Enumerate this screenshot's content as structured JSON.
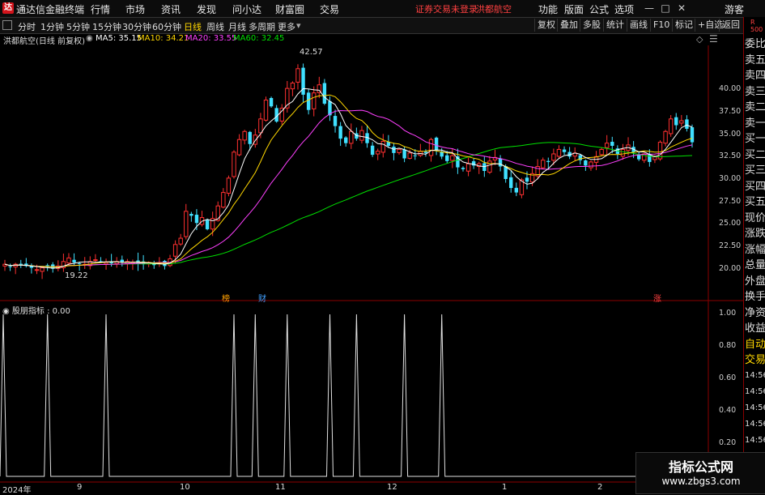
{
  "app": {
    "title": "通达信金融终端",
    "logo": "达"
  },
  "menu": [
    "行情",
    "市场",
    "资讯",
    "发现",
    "问小达",
    "财富圈",
    "交易"
  ],
  "status": {
    "login": "证券交易未登录",
    "stock": "洪都航空"
  },
  "right_menu": [
    "功能",
    "版面",
    "公式",
    "选项",
    "游客"
  ],
  "window_buttons": [
    "—",
    "□",
    "✕"
  ],
  "periods": [
    "分时",
    "1分钟",
    "5分钟",
    "15分钟",
    "30分钟",
    "60分钟",
    "日线",
    "周线",
    "月线",
    "多周期",
    "更多"
  ],
  "active_period": "日线",
  "toolbar_buttons": [
    "复权",
    "叠加",
    "多股",
    "统计",
    "画线",
    "F10",
    "标记",
    "+自选",
    "返回"
  ],
  "right_panel": {
    "head": [
      "R",
      "500"
    ],
    "items": [
      "委比",
      "卖五",
      "卖四",
      "卖三",
      "卖二",
      "卖一",
      "买一",
      "买二",
      "买三",
      "买四",
      "买五",
      "现价",
      "涨跌",
      "涨幅",
      "总量",
      "外盘",
      "换手",
      "净资",
      "收益",
      "自动",
      "交易"
    ],
    "times": [
      "14:56",
      "14:56",
      "14:56",
      "14:56",
      "14:56",
      "14:56",
      "14:56"
    ]
  },
  "legend": {
    "title": "洪都航空(日线 前复权)",
    "ma": [
      {
        "label": "MA5: 35.15",
        "color": "#ffffff"
      },
      {
        "label": "MA10: 34.21",
        "color": "#ffd700"
      },
      {
        "label": "MA20: 33.55",
        "color": "#ff40ff"
      },
      {
        "label": "MA60: 32.45",
        "color": "#00e000"
      }
    ]
  },
  "indicator": {
    "label": "股朋指标 : 0.00"
  },
  "markers": {
    "high": "42.57",
    "low": "19.22",
    "tags": [
      "榜",
      "财",
      "涨"
    ]
  },
  "x_labels": [
    "2024年",
    "9",
    "10",
    "11",
    "12",
    "1",
    "2"
  ],
  "watermark": {
    "title": "指标公式网",
    "url": "www.zbgs3.com"
  },
  "chart_data": [
    {
      "type": "candlestick",
      "title": "洪都航空(日线 前复权)",
      "ylim": [
        17.0,
        45.0
      ],
      "y_ticks": [
        "40.00",
        "37.50",
        "35.00",
        "32.50",
        "30.00",
        "27.50",
        "25.00",
        "22.50",
        "20.00"
      ],
      "close": [
        20.6,
        20.3,
        20.6,
        20.5,
        20.4,
        20.2,
        20.0,
        20.2,
        20.3,
        20.1,
        20.4,
        20.9,
        21.3,
        20.8,
        20.7,
        20.6,
        20.9,
        21.1,
        20.9,
        20.8,
        20.7,
        20.9,
        20.8,
        20.9,
        20.8,
        20.7,
        20.6,
        20.8,
        20.5,
        20.7,
        20.4,
        21.2,
        22.8,
        23.5,
        26.5,
        26.0,
        25.2,
        25.8,
        24.5,
        25.7,
        27.1,
        28.6,
        30.2,
        33.1,
        34.5,
        35.4,
        34.0,
        35.0,
        36.8,
        38.9,
        38.2,
        36.5,
        38.0,
        40.2,
        40.8,
        42.4,
        39.5,
        37.8,
        39.7,
        40.6,
        38.5,
        37.2,
        36.0,
        34.6,
        34.1,
        35.4,
        34.6,
        35.5,
        34.1,
        32.8,
        33.2,
        34.3,
        33.8,
        33.0,
        33.4,
        32.4,
        33.0,
        32.7,
        33.2,
        33.0,
        34.5,
        33.3,
        32.6,
        32.1,
        32.7,
        31.4,
        31.2,
        31.8,
        31.6,
        31.8,
        31.0,
        32.1,
        32.5,
        31.5,
        30.1,
        29.1,
        28.6,
        30.0,
        29.8,
        30.7,
        31.5,
        32.2,
        32.0,
        32.9,
        33.4,
        33.1,
        32.6,
        33.0,
        32.2,
        31.6,
        32.0,
        32.6,
        33.4,
        34.1,
        33.8,
        32.9,
        33.4,
        33.9,
        33.1,
        32.3,
        32.9,
        32.0,
        32.6,
        34.2,
        35.4,
        36.8,
        36.1,
        36.6,
        35.7,
        34.2
      ],
      "series_ma": [
        {
          "name": "MA5",
          "value": 35.15
        },
        {
          "name": "MA10",
          "value": 34.21
        },
        {
          "name": "MA20",
          "value": 33.55
        },
        {
          "name": "MA60",
          "value": 32.45
        }
      ]
    },
    {
      "type": "line",
      "title": "股朋指标",
      "ylim": [
        0,
        1
      ],
      "y_ticks": [
        "1.00",
        "0.80",
        "0.60",
        "0.40",
        "0.20"
      ],
      "spikes_x_px": [],
      "signal_days": [
        0,
        20,
        46,
        106,
        115,
        125,
        148,
        162,
        183,
        198
      ]
    }
  ]
}
